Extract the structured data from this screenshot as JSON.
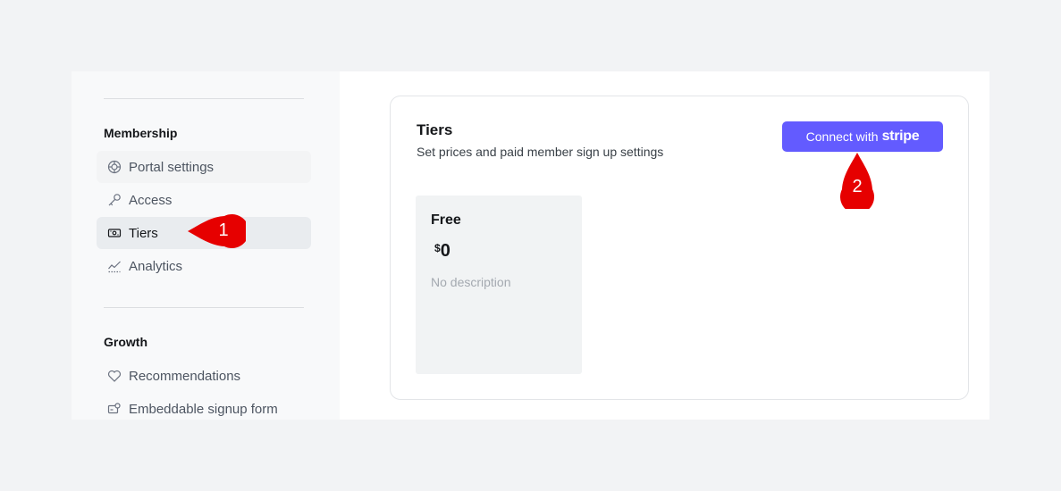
{
  "sidebar": {
    "membership": {
      "title": "Membership",
      "items": [
        {
          "label": "Portal settings",
          "icon": "portal-icon"
        },
        {
          "label": "Access",
          "icon": "key-icon"
        },
        {
          "label": "Tiers",
          "icon": "tiers-icon"
        },
        {
          "label": "Analytics",
          "icon": "analytics-icon"
        }
      ]
    },
    "growth": {
      "title": "Growth",
      "items": [
        {
          "label": "Recommendations",
          "icon": "heart-icon"
        },
        {
          "label": "Embeddable signup form",
          "icon": "signup-form-icon"
        }
      ]
    }
  },
  "tiers": {
    "title": "Tiers",
    "subtitle": "Set prices and paid member sign up settings",
    "stripe_button": {
      "prefix": "Connect with",
      "brand": "stripe"
    },
    "card": {
      "name": "Free",
      "currency": "$",
      "price": "0",
      "description": "No description"
    }
  },
  "callouts": [
    "1",
    "2"
  ],
  "colors": {
    "accent": "#635bff",
    "callout": "#e60000",
    "active_nav": "#e9ecef"
  }
}
